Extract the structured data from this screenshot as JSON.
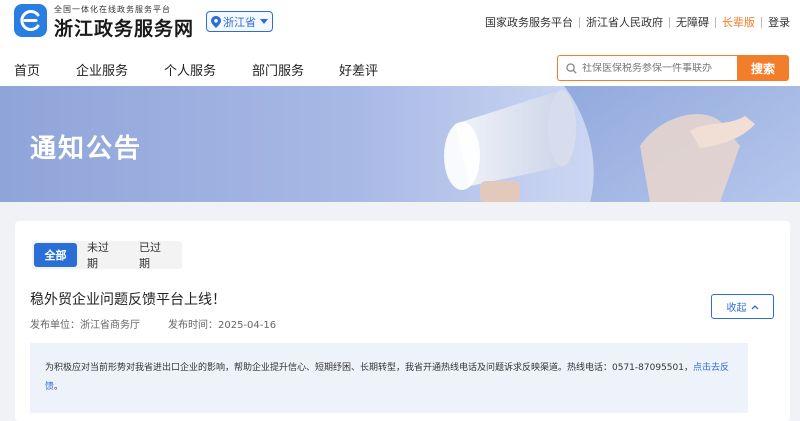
{
  "header": {
    "logo_sub": "全国一体化在线政务服务平台",
    "logo_main": "浙江政务服务网",
    "region": "浙江省",
    "top_links": [
      "国家政务服务平台",
      "浙江省人民政府",
      "无障碍",
      "长辈版",
      "登录"
    ]
  },
  "nav": {
    "items": [
      "首页",
      "企业服务",
      "个人服务",
      "部门服务",
      "好差评"
    ]
  },
  "search": {
    "placeholder": "社保医保税务参保一件事联办",
    "button": "搜索"
  },
  "banner": {
    "title": "通知公告"
  },
  "filters": {
    "tabs": [
      "全部",
      "未过期",
      "已过期"
    ],
    "active": "全部"
  },
  "notice": {
    "title": "稳外贸企业问题反馈平台上线！",
    "publisher_label": "发布单位：",
    "publisher": "浙江省商务厅",
    "date_label": "发布时间：",
    "date": "2025-04-16",
    "collapse": "收起",
    "body_text": "为积极应对当前形势对我省进出口企业的影响，帮助企业提升信心、短期纾困、长期转型，我省开通热线电话及问题诉求反映渠道。热线电话：0571-87095501，",
    "body_link": "点击去反馈",
    "body_end": "。"
  },
  "colors": {
    "brand_blue": "#2a6fd6",
    "accent_orange": "#f27d2a"
  },
  "icons": {
    "logo": "e-logo-icon",
    "region": "location-pin-icon",
    "search": "search-icon",
    "collapse": "chevron-up-icon"
  }
}
